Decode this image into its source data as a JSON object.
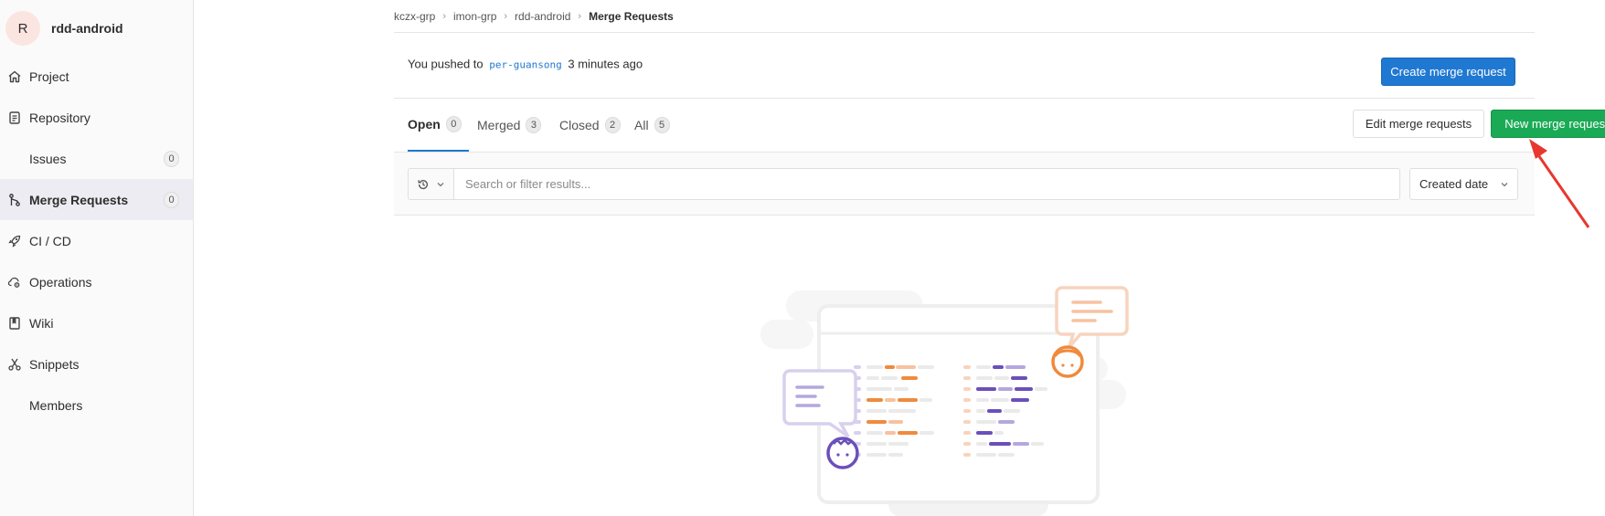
{
  "project": {
    "avatar_letter": "R",
    "name": "rdd-android"
  },
  "sidebar": {
    "items": [
      {
        "label": "Project",
        "icon": "home-icon"
      },
      {
        "label": "Repository",
        "icon": "doc-icon"
      },
      {
        "label": "Issues",
        "badge": "0"
      },
      {
        "label": "Merge Requests",
        "icon": "git-merge-icon",
        "badge": "0",
        "active": true
      },
      {
        "label": "CI / CD",
        "icon": "rocket-icon"
      },
      {
        "label": "Operations",
        "icon": "cloud-gear-icon"
      },
      {
        "label": "Wiki",
        "icon": "book-icon"
      },
      {
        "label": "Snippets",
        "icon": "scissors-icon"
      },
      {
        "label": "Members"
      }
    ]
  },
  "breadcrumb": {
    "items": [
      "kczx-grp",
      "imon-grp",
      "rdd-android",
      "Merge Requests"
    ]
  },
  "push_banner": {
    "prefix": "You pushed to",
    "branch": "per-guansong",
    "suffix": "3 minutes ago",
    "create_button": "Create merge request"
  },
  "tabs": [
    {
      "label": "Open",
      "count": "0"
    },
    {
      "label": "Merged",
      "count": "3"
    },
    {
      "label": "Closed",
      "count": "2"
    },
    {
      "label": "All",
      "count": "5"
    }
  ],
  "actions": {
    "edit_button": "Edit merge requests",
    "new_button": "New merge request"
  },
  "filter": {
    "placeholder": "Search or filter results...",
    "sort_label": "Created date"
  },
  "colors": {
    "primary_blue": "#1f78d1",
    "success_green": "#1aaa55",
    "annotation_red": "#e8372e"
  }
}
